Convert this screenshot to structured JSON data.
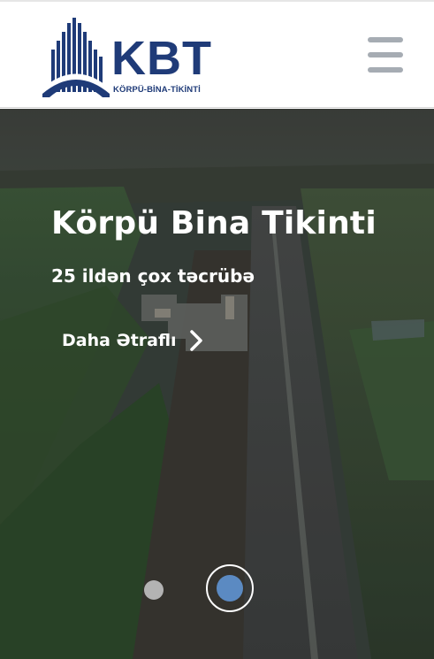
{
  "brand": {
    "name": "KBT",
    "tagline": "KÖRPÜ-BİNA-TİKİNTİ",
    "logo_color": "#1f3b78"
  },
  "header": {
    "menu_icon": "hamburger-menu-icon",
    "menu_icon_color": "#a6acb3"
  },
  "hero": {
    "title": "Körpü Bina Tikinti",
    "subtitle": "25 ildən çox təcrübə",
    "cta_label": "Daha Ətraflı",
    "cta_icon": "chevron-right-icon",
    "background": "aerial-highway-construction-photo",
    "slides": [
      {
        "active": false,
        "color": "#b3b3b3"
      },
      {
        "active": true,
        "color": "#5b8ac2"
      }
    ]
  }
}
